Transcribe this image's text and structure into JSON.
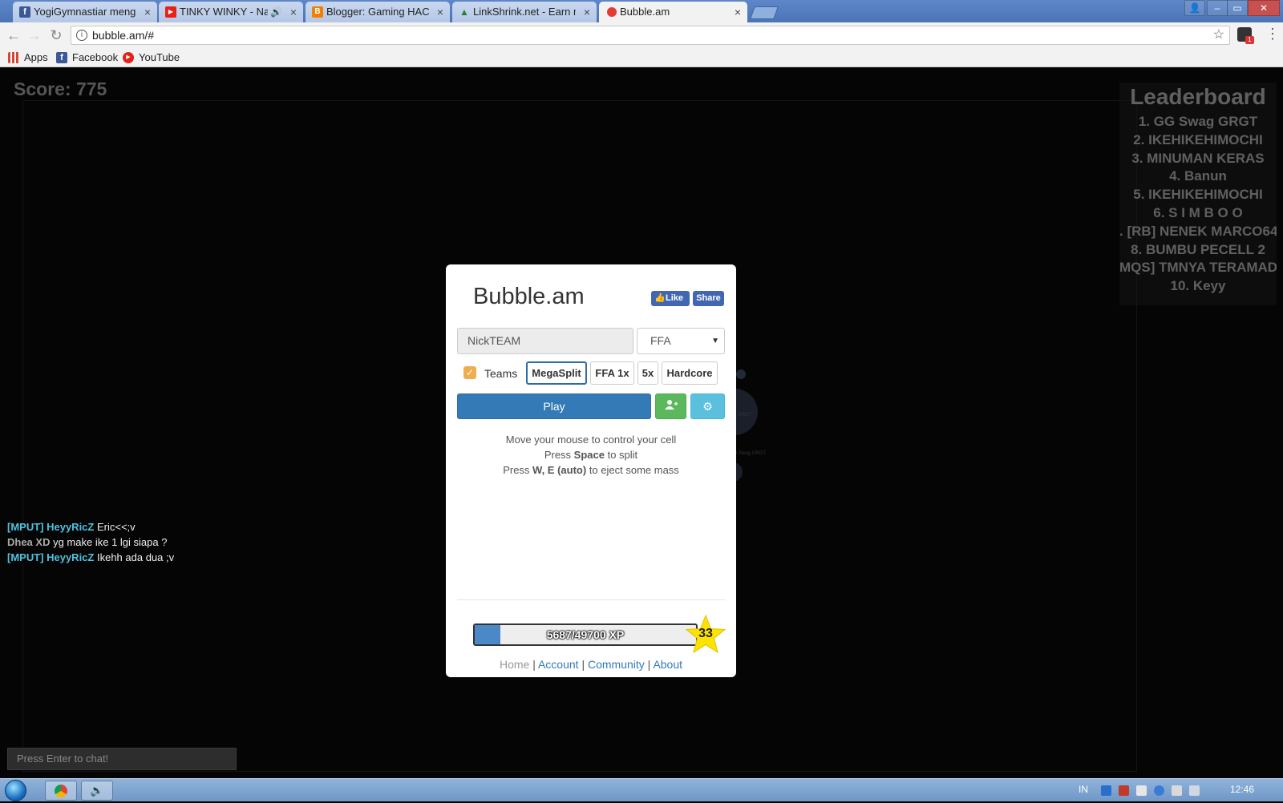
{
  "browser": {
    "tabs": [
      {
        "title": "YogiGymnastiar mengirim",
        "close": "×",
        "favicon_color": "#3b5998",
        "favicon_glyph": "f"
      },
      {
        "title": "TINKY WINKY - Nafas",
        "close": "×",
        "audio": "🔊",
        "favicon_color": "#e62117",
        "favicon_glyph": "▶"
      },
      {
        "title": "Blogger: Gaming HACKIN",
        "close": "×",
        "favicon_color": "#f57d00",
        "favicon_glyph": "B"
      },
      {
        "title": "LinkShrink.net - Earn mo",
        "close": "×",
        "favicon_color": "#2e7d32",
        "favicon_glyph": "▲"
      },
      {
        "title": "Bubble.am",
        "close": "×",
        "favicon_color": "#e53935",
        "favicon_glyph": ""
      }
    ],
    "window_controls": {
      "user": "👤",
      "minimize": "–",
      "maximize": "▭",
      "close": "✕"
    },
    "url": "bubble.am/#",
    "info_glyph": "i",
    "star_glyph": "☆",
    "back_glyph": "←",
    "forward_glyph": "→",
    "reload_glyph": "↻",
    "ext_badge": "1",
    "menu_glyph": "⋮",
    "bookmarks": [
      {
        "label": "Apps",
        "icon": "apps-icon",
        "color": "#d14836"
      },
      {
        "label": "Facebook",
        "icon": "facebook-icon",
        "color": "#3b5998"
      },
      {
        "label": "YouTube",
        "icon": "youtube-icon",
        "color": "#e62117"
      }
    ]
  },
  "game": {
    "score": "Score: 775",
    "leaderboard": {
      "title": "Leaderboard",
      "rows": [
        "1. GG Swag GRGT",
        "2. IKEHIKEHIMOCHI",
        "3. MINUMAN KERAS",
        "4. Banun",
        "5. IKEHIKEHIMOCHI",
        "6. S I M B O O",
        ". [RB] NENEK MARCO64",
        "8. BUMBU PECELL 2",
        "MQS] TMNYA TERAMAD",
        "10. Keyy"
      ]
    },
    "cell_labels": {
      "big": "GRGT",
      "name": "GG Swag GRGT"
    },
    "chat": [
      {
        "name": "[MPUT] HeyyRicZ",
        "message": "Eric<<;v",
        "name_style": "cyan"
      },
      {
        "name": "Dhea XD",
        "message": "yg make ike 1 lgi siapa ?",
        "name_style": "grey"
      },
      {
        "name": "[MPUT] HeyyRicZ",
        "message": "Ikehh ada dua ;v",
        "name_style": "cyan"
      }
    ],
    "chat_placeholder": "Press Enter to chat!"
  },
  "modal": {
    "title": "Bubble.am",
    "fb_like": "Like",
    "fb_share": "Share",
    "nick_placeholder": "NickTEAM",
    "mode_selected": "FFA",
    "teams_label": "Teams",
    "teams_checked": true,
    "mode_buttons": [
      "MegaSplit",
      "FFA 1x",
      "5x",
      "Hardcore"
    ],
    "active_mode": "MegaSplit",
    "play_label": "Play",
    "friend_glyph": "👥",
    "settings_glyph": "⚙",
    "instructions": {
      "line1": "Move your mouse to control your cell",
      "line2_pre": "Press ",
      "line2_key": "Space",
      "line2_post": " to split",
      "line3_pre": "Press ",
      "line3_key": "W, E (auto)",
      "line3_post": " to eject some mass"
    },
    "xp": {
      "text": "5687/49700 XP",
      "current": 5687,
      "max": 49700
    },
    "level": "33",
    "footer": {
      "home": "Home",
      "account": "Account",
      "community": "Community",
      "about": "About",
      "sep": " | "
    }
  },
  "taskbar": {
    "lang": "IN",
    "clock": "12:46"
  }
}
